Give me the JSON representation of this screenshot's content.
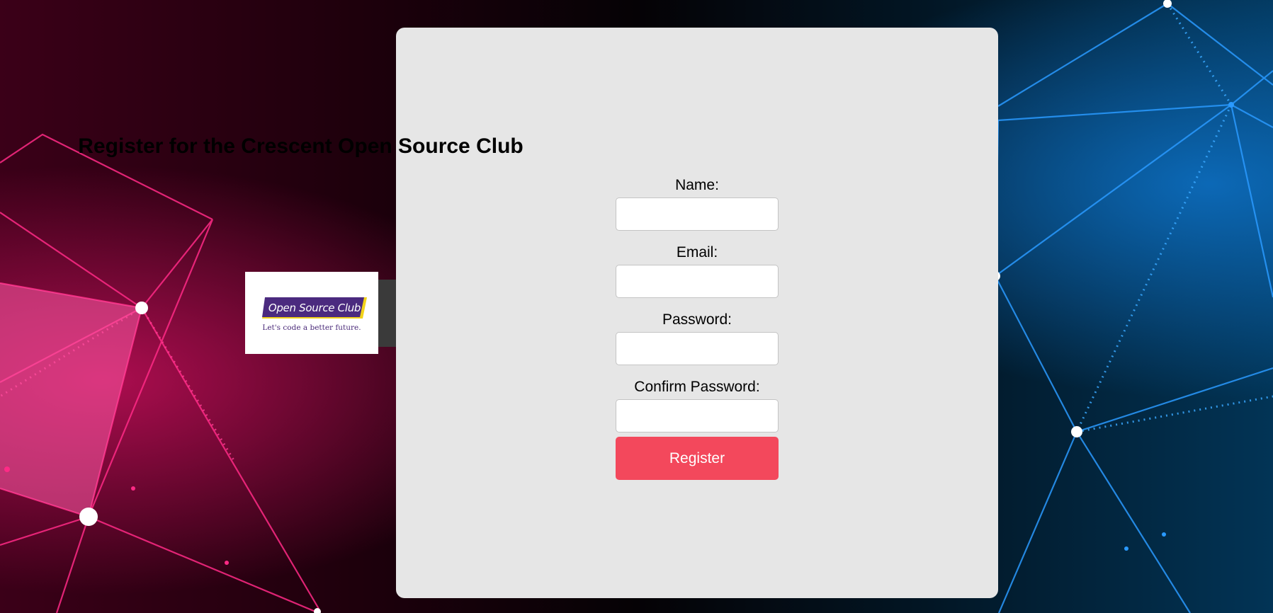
{
  "page": {
    "title": "Register for the Crescent Open Source Club"
  },
  "logo": {
    "name": "Open Source Club",
    "tagline": "Let's code a better future."
  },
  "form": {
    "name_label": "Name:",
    "name_value": "",
    "email_label": "Email:",
    "email_value": "",
    "password_label": "Password:",
    "password_value": "",
    "confirm_label": "Confirm Password:",
    "confirm_value": "",
    "submit_label": "Register"
  },
  "colors": {
    "card_background": "#e6e6e6",
    "button_accent": "#f3485c",
    "logo_purple": "#4b2a7f",
    "logo_yellow": "#f2d31a",
    "background_left": "#d11463",
    "background_right": "#1c7fd6"
  }
}
